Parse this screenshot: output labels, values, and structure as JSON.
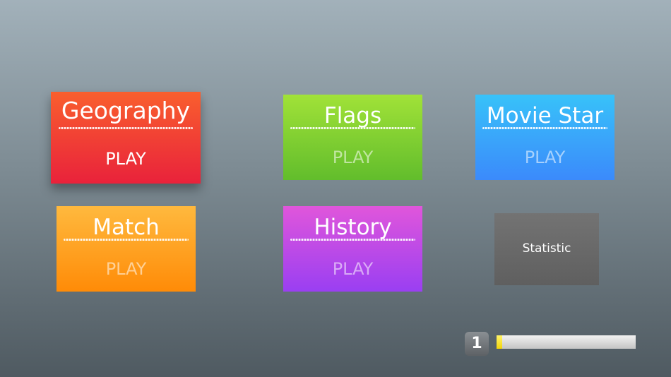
{
  "categories": [
    {
      "id": "geography",
      "title": "Geography",
      "action": "PLAY",
      "color": "#ef3b35",
      "focused": true
    },
    {
      "id": "flags",
      "title": "Flags",
      "action": "PLAY",
      "color": "#7ccf30"
    },
    {
      "id": "movie_star",
      "title": "Movie Star",
      "action": "PLAY",
      "color": "#39a8fa"
    },
    {
      "id": "match",
      "title": "Match",
      "action": "PLAY",
      "color": "#ffa122"
    },
    {
      "id": "history",
      "title": "History",
      "action": "PLAY",
      "color": "#bc4be7"
    }
  ],
  "statistic": {
    "label": "Statistic",
    "color": "#6a6a6a"
  },
  "level": {
    "number": "1",
    "progress_fraction": 0.04,
    "progress_color": "#f5dc14"
  }
}
